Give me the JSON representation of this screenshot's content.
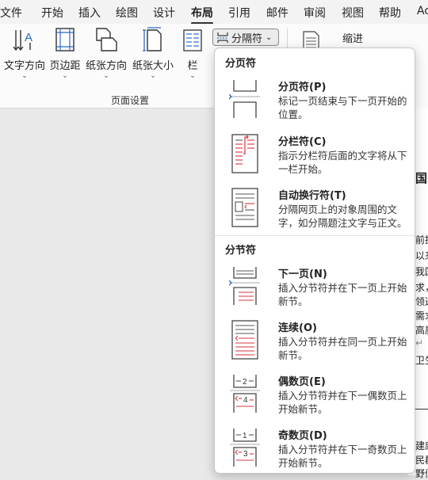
{
  "tabs": [
    {
      "label": "文件",
      "active": false
    },
    {
      "label": "开始",
      "active": false
    },
    {
      "label": "插入",
      "active": false
    },
    {
      "label": "绘图",
      "active": false
    },
    {
      "label": "设计",
      "active": false
    },
    {
      "label": "布局",
      "active": true
    },
    {
      "label": "引用",
      "active": false
    },
    {
      "label": "邮件",
      "active": false
    },
    {
      "label": "审阅",
      "active": false
    },
    {
      "label": "视图",
      "active": false
    },
    {
      "label": "帮助",
      "active": false
    },
    {
      "label": "Ac",
      "active": false
    }
  ],
  "ribbon": {
    "buttons": [
      {
        "label": "文字方向",
        "icon": "text-direction-icon"
      },
      {
        "label": "页边距",
        "icon": "margins-icon"
      },
      {
        "label": "纸张方向",
        "icon": "orientation-icon"
      },
      {
        "label": "纸张大小",
        "icon": "page-size-icon"
      },
      {
        "label": "栏",
        "icon": "columns-icon"
      }
    ],
    "breaks_button": "分隔符",
    "indent_label": "缩进",
    "group_label": "页面设置"
  },
  "menu": {
    "page_breaks_header": "分页符",
    "section_breaks_header": "分节符",
    "items": [
      {
        "title": "分页符(P)",
        "desc": "标记一页结束与下一页开始的位置。",
        "icon": "page-break-icon"
      },
      {
        "title": "分栏符(C)",
        "desc": "指示分栏符后面的文字将从下一栏开始。",
        "icon": "column-break-icon"
      },
      {
        "title": "自动换行符(T)",
        "desc": "分隔网页上的对象周围的文字，如分隔题注文字与正文。",
        "icon": "text-wrapping-break-icon"
      },
      {
        "title": "下一页(N)",
        "desc": "插入分节符并在下一页上开始新节。",
        "icon": "next-page-section-icon"
      },
      {
        "title": "连续(O)",
        "desc": "插入分节符并在同一页上开始新节。",
        "icon": "continuous-section-icon"
      },
      {
        "title": "偶数页(E)",
        "desc": "插入分节符并在下一偶数页上开始新节。",
        "icon": "even-page-section-icon"
      },
      {
        "title": "奇数页(D)",
        "desc": "插入分节符并在下一奇数页上开始新节。",
        "icon": "odd-page-section-icon"
      }
    ]
  },
  "document": {
    "lines": [
      "国",
      "前提",
      "以来",
      "我国",
      "求，",
      "领过",
      "需求",
      "高质",
      "↵",
      "卫生",
      "建康",
      "民群",
      "野们"
    ]
  },
  "colors": {
    "accent_red": "#d9333b",
    "accent_blue": "#2b6cc4"
  }
}
